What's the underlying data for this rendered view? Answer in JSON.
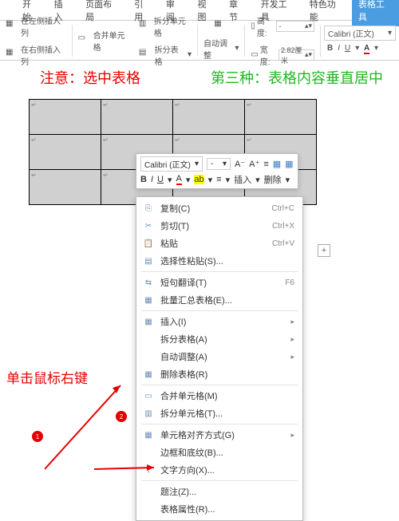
{
  "tabs": {
    "start": "开始",
    "insert": "插入",
    "layout": "页面布局",
    "ref": "引用",
    "review": "审阅",
    "view": "视图",
    "chapter": "章节",
    "dev": "开发工具",
    "special": "特色功能",
    "table_tools": "表格工具"
  },
  "toolbar": {
    "insert_left": "在左侧插入列",
    "insert_right": "在右侧插入列",
    "merge": "合并单元格",
    "split_cell": "拆分单元格",
    "split_table": "拆分表格",
    "auto_adjust": "自动调整",
    "height": "高度:",
    "width": "宽度:",
    "height_val": "-",
    "width_val": "2.82厘米",
    "font": "Calibri (正文)",
    "bold": "B",
    "italic": "I",
    "underline": "U"
  },
  "annotations": {
    "note": "注意：选中表格",
    "method3": "第三种：表格内容垂直居中",
    "rightclick": "单击鼠标右键",
    "badge1": "1",
    "badge2": "2"
  },
  "mini": {
    "font": "Calibri (正文)",
    "bold": "B",
    "italic": "I",
    "underline": "U",
    "insert": "插入",
    "delete": "删除"
  },
  "ctx": {
    "copy": "复制(C)",
    "copy_sc": "Ctrl+C",
    "cut": "剪切(T)",
    "cut_sc": "Ctrl+X",
    "paste": "粘贴",
    "paste_sc": "Ctrl+V",
    "paste_special": "选择性粘贴(S)...",
    "translate": "短句翻译(T)",
    "translate_sc": "F6",
    "batch": "批量汇总表格(E)...",
    "insert": "插入(I)",
    "split_table": "拆分表格(A)",
    "auto_adjust": "自动调整(A)",
    "delete_table": "删除表格(R)",
    "merge": "合并单元格(M)",
    "split_cell": "拆分单元格(T)...",
    "align": "单元格对齐方式(G)",
    "border": "边框和底纹(B)...",
    "text_dir": "文字方向(X)...",
    "caption": "题注(Z)...",
    "props": "表格属性(R)..."
  }
}
